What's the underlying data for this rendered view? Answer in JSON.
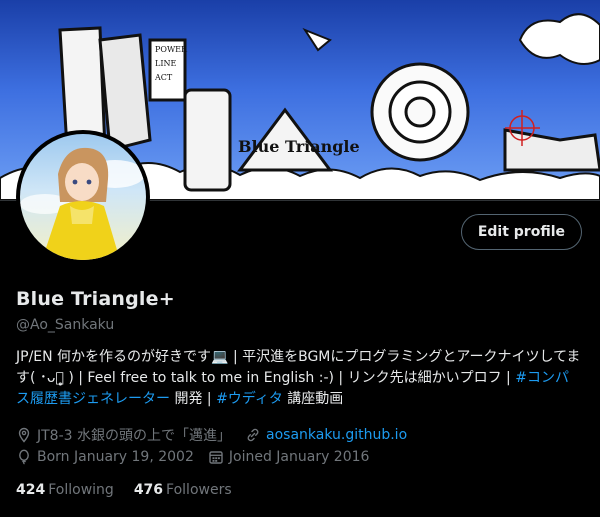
{
  "header": {
    "banner_text": "Blue Triangle",
    "banner_small_words": [
      "POWER",
      "LINE",
      "ACT"
    ]
  },
  "actions": {
    "edit_profile_label": "Edit profile"
  },
  "profile": {
    "display_name": "Blue Triangle+",
    "handle": "@Ao_Sankaku",
    "bio": {
      "part1": "JP/EN 何かを作るのが好きです💻 | 平沢進をBGMにプログラミングとアークナイツしてます( ･ᴗ･̥̥̥ ) | Feel free to talk to me in English :-) | リンク先は細かいプロフ | ",
      "hashtag1": "#コンパス履歴書ジェネレーター",
      "part2": " 開発 | ",
      "hashtag2": "#ウディタ",
      "part3": " 講座動画"
    },
    "location": "JT8-3 水銀の頭の上で「邁進」",
    "website": "aosankaku.github.io",
    "birthday": "Born January 19, 2002",
    "joined": "Joined January 2016"
  },
  "stats": {
    "following_count": "424",
    "following_label": "Following",
    "followers_count": "476",
    "followers_label": "Followers"
  },
  "icons": {
    "location": "location-pin-icon",
    "website": "link-icon",
    "birthday": "balloon-icon",
    "joined": "calendar-icon"
  },
  "colors": {
    "background": "#000000",
    "text": "#e7e9ea",
    "secondary": "#71767b",
    "link": "#1d9bf0",
    "border": "#536471"
  }
}
